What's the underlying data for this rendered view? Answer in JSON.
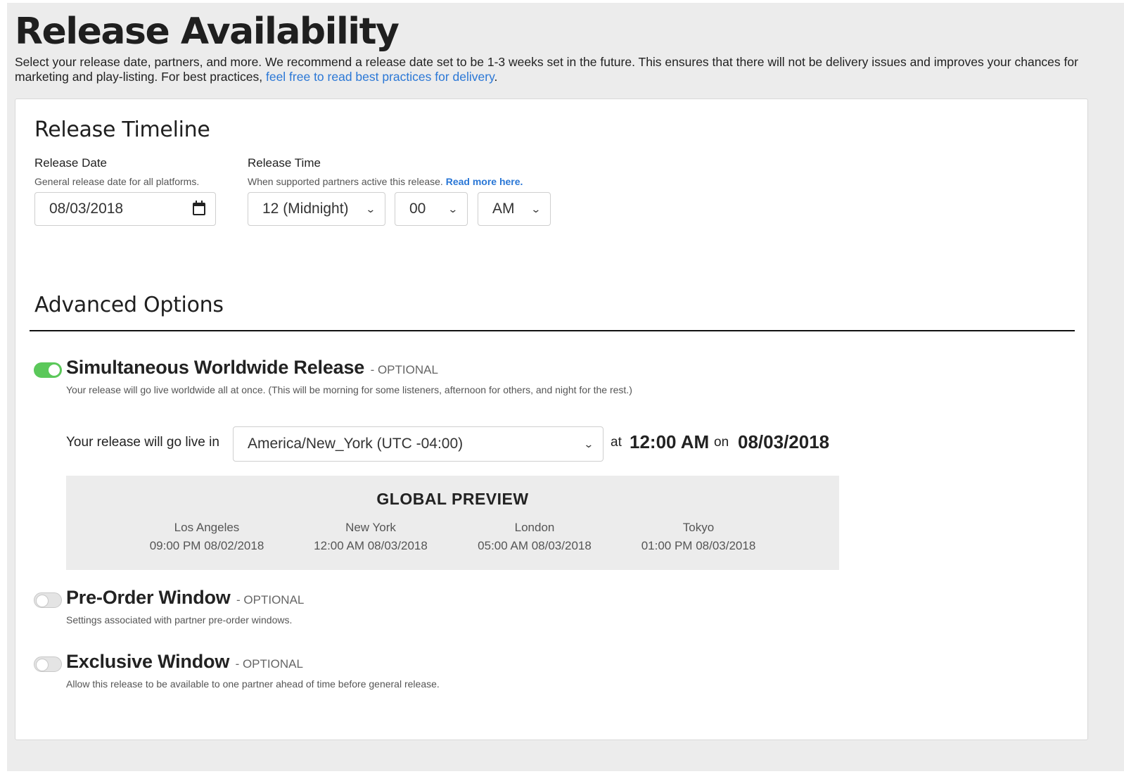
{
  "header": {
    "title": "Release Availability",
    "intro_text": "Select your release date, partners, and more. We recommend a release date set to be 1-3 weeks set in the future. This ensures that there will not be delivery issues and improves your chances for marketing and play-listing. For best practices, ",
    "intro_link": "feel free to read best practices for delivery",
    "intro_end": "."
  },
  "timeline": {
    "title": "Release Timeline",
    "date_label": "Release Date",
    "date_help": "General release date for all platforms.",
    "date_value": "08/03/2018",
    "time_label": "Release Time",
    "time_help": "When supported partners active this release. ",
    "time_help_link": "Read more here.",
    "hour_value": "12 (Midnight)",
    "minute_value": "00",
    "ampm_value": "AM"
  },
  "advanced": {
    "title": "Advanced Options",
    "options": [
      {
        "name": "Simultaneous Worldwide Release",
        "tag": "- OPTIONAL",
        "desc": "Your release will go live worldwide all at once. (This will be morning for some listeners, afternoon for others, and night for the rest.)",
        "enabled": true
      },
      {
        "name": "Pre-Order Window",
        "tag": "- OPTIONAL",
        "desc": "Settings associated with partner pre-order windows.",
        "enabled": false
      },
      {
        "name": "Exclusive Window",
        "tag": "- OPTIONAL",
        "desc": "Allow this release to be available to one partner ahead of time before general release.",
        "enabled": false
      }
    ]
  },
  "golive": {
    "label": "Your release will go live in",
    "timezone_value": "America/New_York (UTC -04:00)",
    "at_text": "at",
    "time": "12:00 AM",
    "on_text": "on",
    "date": "08/03/2018"
  },
  "preview": {
    "title": "GLOBAL PREVIEW",
    "cities": [
      {
        "name": "Los Angeles",
        "time": "09:00 PM 08/02/2018"
      },
      {
        "name": "New York",
        "time": "12:00 AM 08/03/2018"
      },
      {
        "name": "London",
        "time": "05:00 AM 08/03/2018"
      },
      {
        "name": "Tokyo",
        "time": "01:00 PM 08/03/2018"
      }
    ]
  },
  "colors": {
    "toggle_on": "#5bc85a",
    "link": "#2a77d6",
    "background": "#ececec"
  },
  "icons": {
    "date_picker": "calendar-icon",
    "dropdown": "chevron-down-icon"
  }
}
